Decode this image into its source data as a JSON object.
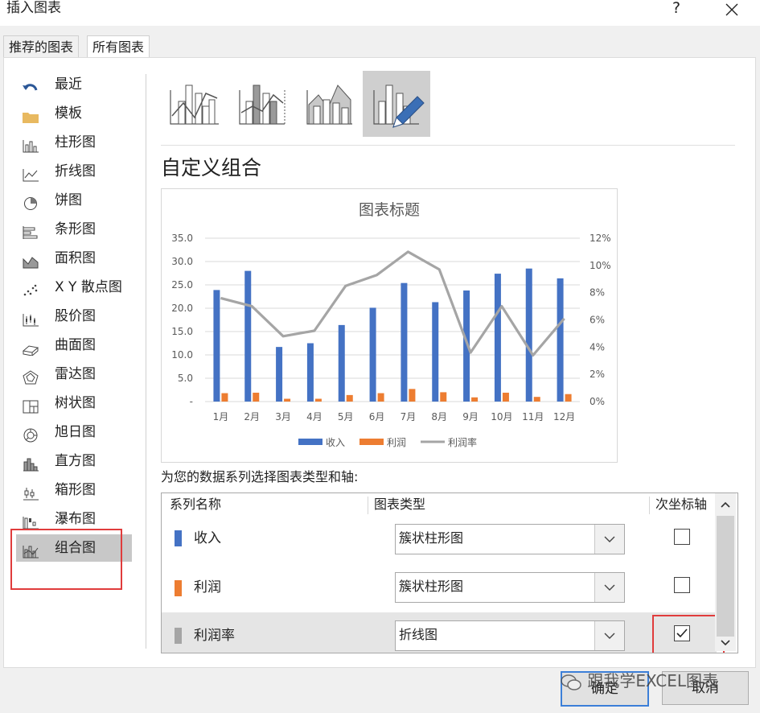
{
  "dialog": {
    "title": "插入图表",
    "help": "?",
    "close_icon": "close-icon"
  },
  "tabs": [
    {
      "label": "推荐的图表"
    },
    {
      "label": "所有图表"
    }
  ],
  "sidebar": {
    "items": [
      {
        "label": "最近",
        "icon": "undo-icon"
      },
      {
        "label": "模板",
        "icon": "folder-icon"
      },
      {
        "label": "柱形图",
        "icon": "column-chart-icon"
      },
      {
        "label": "折线图",
        "icon": "line-chart-icon"
      },
      {
        "label": "饼图",
        "icon": "pie-chart-icon"
      },
      {
        "label": "条形图",
        "icon": "bar-chart-icon"
      },
      {
        "label": "面积图",
        "icon": "area-chart-icon"
      },
      {
        "label": "X Y 散点图",
        "icon": "scatter-chart-icon"
      },
      {
        "label": "股价图",
        "icon": "stock-chart-icon"
      },
      {
        "label": "曲面图",
        "icon": "surface-chart-icon"
      },
      {
        "label": "雷达图",
        "icon": "radar-chart-icon"
      },
      {
        "label": "树状图",
        "icon": "treemap-icon"
      },
      {
        "label": "旭日图",
        "icon": "sunburst-icon"
      },
      {
        "label": "直方图",
        "icon": "histogram-icon"
      },
      {
        "label": "箱形图",
        "icon": "box-whisker-icon"
      },
      {
        "label": "瀑布图",
        "icon": "waterfall-icon"
      },
      {
        "label": "组合图",
        "icon": "combo-chart-icon"
      }
    ],
    "selected": "组合图"
  },
  "main": {
    "heading": "自定义组合",
    "instruction": "为您的数据系列选择图表类型和轴:"
  },
  "series_table": {
    "headers": {
      "name": "系列名称",
      "type": "图表类型",
      "axis": "次坐标轴"
    },
    "rows": [
      {
        "name": "收入",
        "type": "簇状柱形图",
        "secondary": false,
        "color": "#4472c4"
      },
      {
        "name": "利润",
        "type": "簇状柱形图",
        "secondary": false,
        "color": "#ed7d31"
      },
      {
        "name": "利润率",
        "type": "折线图",
        "secondary": true,
        "color": "#a5a5a5"
      }
    ]
  },
  "buttons": {
    "ok": "确定",
    "cancel": "取消"
  },
  "watermark": "跟我学EXCEL图表",
  "chart_data": {
    "type": "bar",
    "title": "图表标题",
    "categories": [
      "1月",
      "2月",
      "3月",
      "4月",
      "5月",
      "6月",
      "7月",
      "8月",
      "9月",
      "10月",
      "11月",
      "12月"
    ],
    "y_ticks": [
      "35.0",
      "30.0",
      "25.0",
      "20.0",
      "15.0",
      "10.0",
      "5.0",
      "-"
    ],
    "y2_ticks": [
      "12%",
      "10%",
      "8%",
      "6%",
      "4%",
      "2%",
      "0%"
    ],
    "ylim": [
      0,
      35
    ],
    "y2lim": [
      0,
      0.12
    ],
    "series": [
      {
        "name": "收入",
        "type": "bar",
        "axis": "primary",
        "color": "#4472c4",
        "values": [
          23.9,
          28.0,
          11.7,
          12.5,
          16.4,
          20.1,
          25.4,
          21.3,
          23.8,
          27.4,
          28.5,
          26.4
        ]
      },
      {
        "name": "利润",
        "type": "bar",
        "axis": "primary",
        "color": "#ed7d31",
        "values": [
          1.8,
          1.9,
          0.6,
          0.6,
          1.4,
          1.8,
          2.7,
          2.0,
          0.9,
          1.9,
          1.0,
          1.6
        ]
      },
      {
        "name": "利润率",
        "type": "line",
        "axis": "secondary",
        "color": "#a5a5a5",
        "values": [
          0.076,
          0.07,
          0.048,
          0.052,
          0.085,
          0.093,
          0.11,
          0.097,
          0.036,
          0.07,
          0.034,
          0.061
        ]
      }
    ],
    "legend": "bottom",
    "grid": true
  }
}
